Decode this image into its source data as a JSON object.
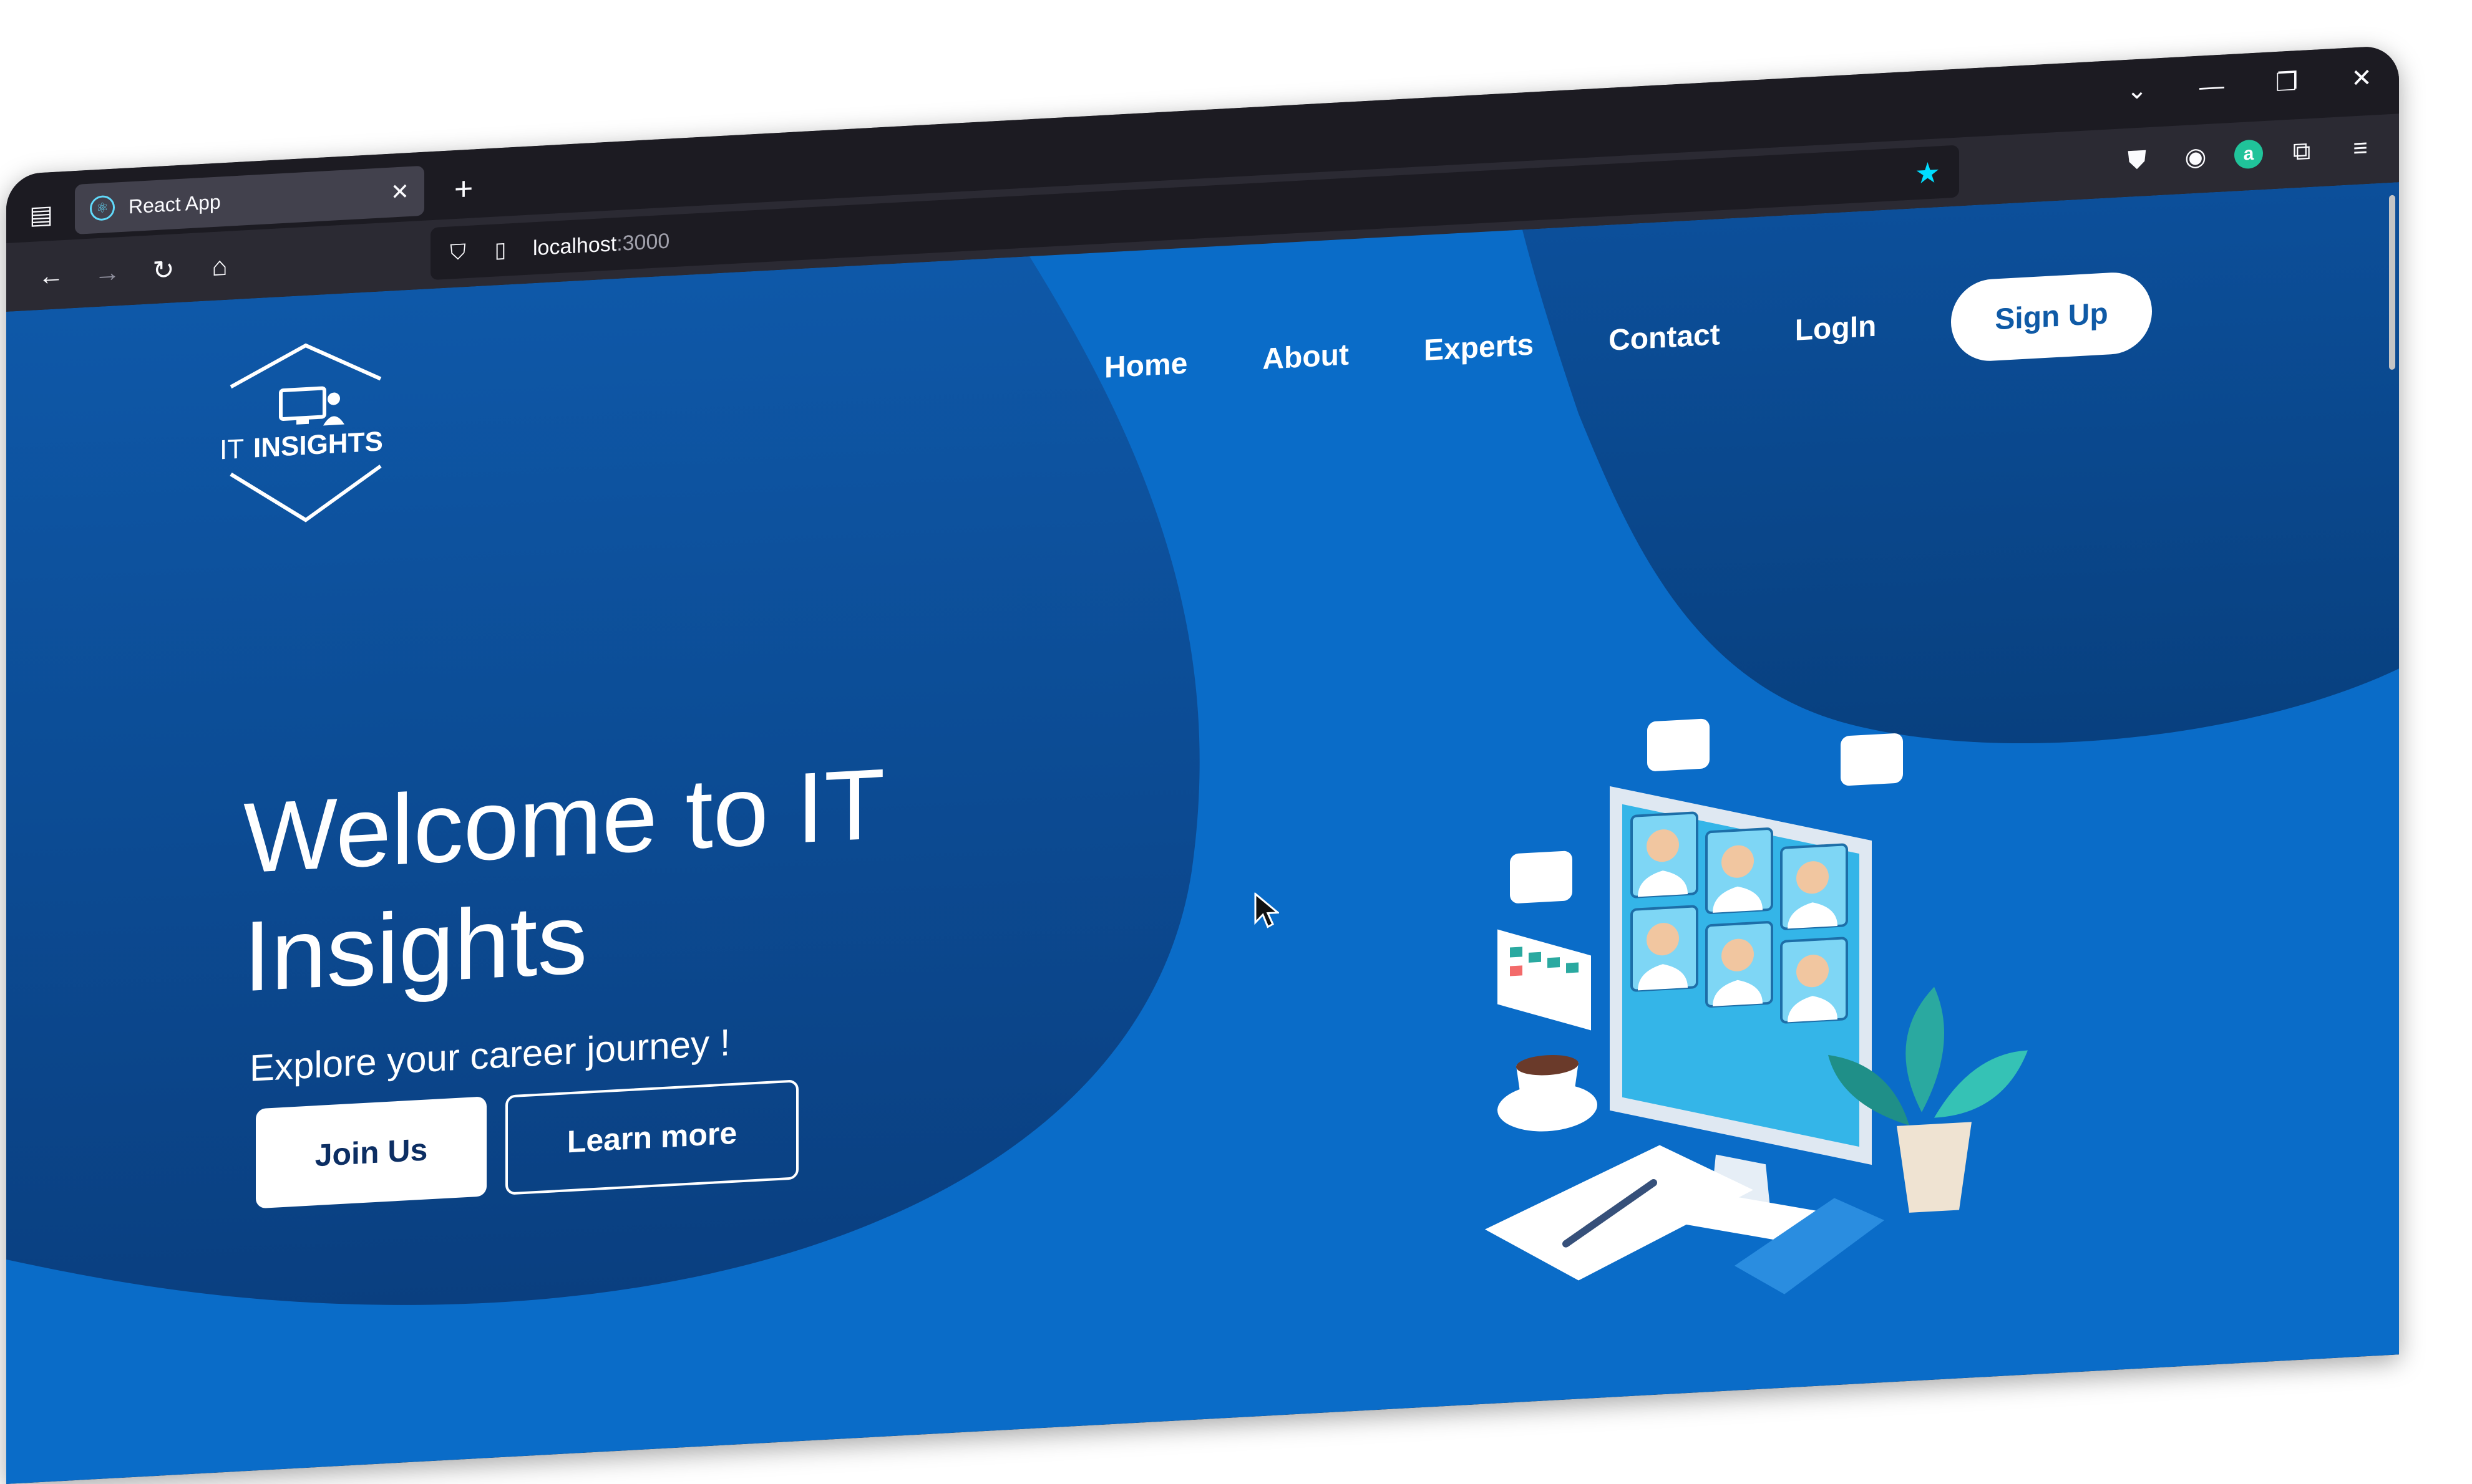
{
  "browser": {
    "tab_title": "React App",
    "url_host": "localhost",
    "url_port": ":3000"
  },
  "nav": {
    "items": [
      "Home",
      "About",
      "Experts",
      "Contact",
      "LogIn"
    ],
    "signup_label": "Sign Up"
  },
  "logo": {
    "text_it": "IT",
    "text_insights": "INSIGHTS"
  },
  "hero": {
    "title": "Welcome to IT Insights",
    "subtitle": "Explore your career journey !",
    "join_label": "Join Us",
    "learn_label": "Learn more"
  },
  "colors": {
    "page_bg": "#0a6cc8",
    "dark_blob": "#0b4a94",
    "browser_bg": "#1c1b22",
    "toolbar_bg": "#2b2a33"
  }
}
